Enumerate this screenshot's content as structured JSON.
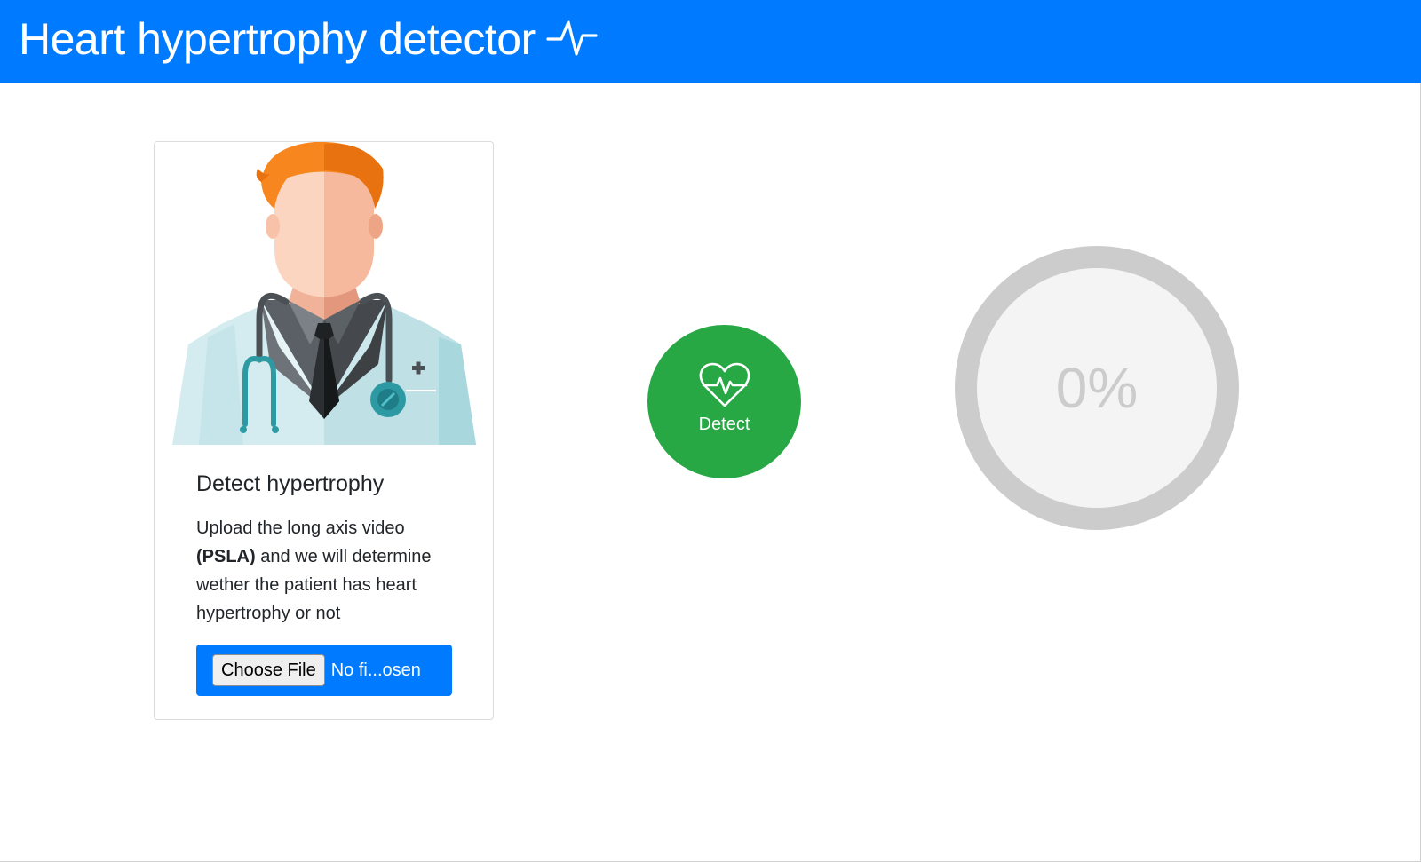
{
  "header": {
    "title": "Heart hypertrophy detector",
    "icon": "pulse-icon",
    "background": "#007bff"
  },
  "card": {
    "illustration": "doctor-illustration",
    "title": "Detect hypertrophy",
    "text_before": "Upload the long axis video ",
    "text_bold": "(PSLA)",
    "text_after": " and we will determine wether the patient has heart hypertrophy or not",
    "file_button_label": "Choose File",
    "file_status": "No fi...osen"
  },
  "detect": {
    "icon": "heart-pulse-icon",
    "label": "Detect",
    "color": "#28a745"
  },
  "progress": {
    "value": 0,
    "label": "0%"
  }
}
